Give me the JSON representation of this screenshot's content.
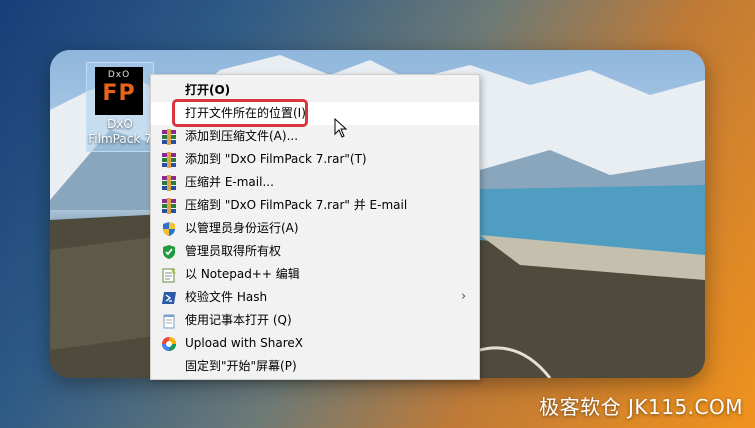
{
  "desktop_icon": {
    "logo_top": "DxO",
    "logo_main": "FP",
    "label_line1": "DxO",
    "label_line2": "FilmPack 7"
  },
  "context_menu": {
    "items": [
      {
        "label": "打开(O)",
        "icon": "none",
        "bold": true
      },
      {
        "label": "打开文件所在的位置(I)",
        "icon": "none",
        "highlighted": true
      },
      {
        "label": "添加到压缩文件(A)...",
        "icon": "winrar-icon"
      },
      {
        "label": "添加到 \"DxO FilmPack 7.rar\"(T)",
        "icon": "winrar-icon"
      },
      {
        "label": "压缩并 E-mail...",
        "icon": "winrar-icon"
      },
      {
        "label": "压缩到 \"DxO FilmPack 7.rar\" 并 E-mail",
        "icon": "winrar-icon"
      },
      {
        "label": "以管理员身份运行(A)",
        "icon": "uac-shield-icon"
      },
      {
        "label": "管理员取得所有权",
        "icon": "green-shield-icon"
      },
      {
        "label": "以 Notepad++ 编辑",
        "icon": "notepadpp-icon"
      },
      {
        "label": "校验文件 Hash",
        "icon": "powershell-icon",
        "submenu": true
      },
      {
        "label": "使用记事本打开 (Q)",
        "icon": "notepad-icon"
      },
      {
        "label": "Upload with ShareX",
        "icon": "sharex-icon"
      },
      {
        "label": "固定到\"开始\"屏幕(P)",
        "icon": "none"
      }
    ]
  },
  "submenu_arrow": "›",
  "watermark": "极客软仓 JK115.COM",
  "colors": {
    "highlight_border": "#d9363e",
    "menu_bg": "#f2f2f2",
    "logo_accent": "#e8641c"
  }
}
